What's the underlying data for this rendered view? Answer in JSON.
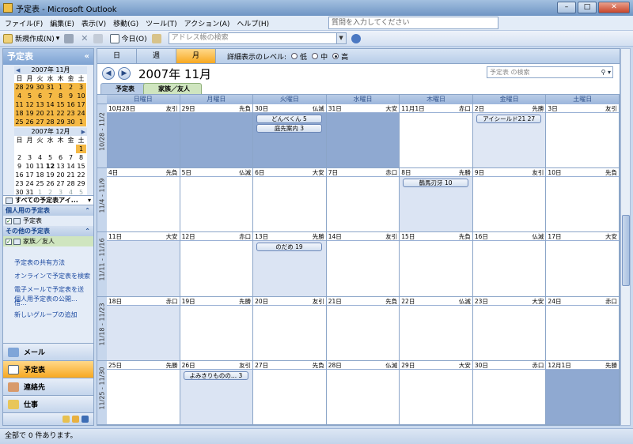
{
  "window": {
    "title": "予定表 - Microsoft Outlook"
  },
  "menu": {
    "items": [
      "ファイル(F)",
      "編集(E)",
      "表示(V)",
      "移動(G)",
      "ツール(T)",
      "アクション(A)",
      "ヘルプ(H)"
    ],
    "help_placeholder": "質問を入力してください"
  },
  "toolbar": {
    "new_label": "新規作成(N)",
    "today_label": "今日(O)",
    "address_placeholder": "アドレス帳の検索"
  },
  "leftpane": {
    "title": "予定表",
    "minical1": {
      "title": "2007年 11月",
      "headers": [
        "日",
        "月",
        "火",
        "水",
        "木",
        "金",
        "土"
      ],
      "days": [
        "28",
        "29",
        "30",
        "31",
        "1",
        "2",
        "3",
        "4",
        "5",
        "6",
        "7",
        "8",
        "9",
        "10",
        "11",
        "12",
        "13",
        "14",
        "15",
        "16",
        "17",
        "18",
        "19",
        "20",
        "21",
        "22",
        "23",
        "24",
        "25",
        "26",
        "27",
        "28",
        "29",
        "30",
        "1"
      ]
    },
    "minical2": {
      "title": "2007年 12月",
      "headers": [
        "日",
        "月",
        "火",
        "水",
        "木",
        "金",
        "土"
      ],
      "days": [
        "",
        "",
        "",
        "",
        "",
        "",
        "1",
        "2",
        "3",
        "4",
        "5",
        "6",
        "7",
        "8",
        "9",
        "10",
        "11",
        "12",
        "13",
        "14",
        "15",
        "16",
        "17",
        "18",
        "19",
        "20",
        "21",
        "22",
        "23",
        "24",
        "25",
        "26",
        "27",
        "28",
        "29",
        "30",
        "31",
        "1",
        "2",
        "3",
        "4",
        "5"
      ]
    },
    "all_calendars": "すべての予定表アイ...",
    "personal_header": "個人用の予定表",
    "personal_item": "予定表",
    "other_header": "その他の予定表",
    "other_item": "家族／友人",
    "links": [
      "予定表の共有方法",
      "オンラインで予定表を検索",
      "電子メールで予定表を送信...",
      "個人用予定表の公開...",
      "新しいグループの追加"
    ],
    "nav": [
      "メール",
      "予定表",
      "連絡先",
      "仕事"
    ]
  },
  "view": {
    "tabs": [
      "日",
      "週",
      "月"
    ],
    "detail_label": "詳細表示のレベル:",
    "levels": [
      "低",
      "中",
      "高"
    ],
    "month_title": "2007年 11月",
    "search_placeholder": "予定表 の検索",
    "cal_tabs": [
      "予定表",
      "家族／友人"
    ]
  },
  "calendar": {
    "weekdays": [
      "日曜日",
      "月曜日",
      "火曜日",
      "水曜日",
      "木曜日",
      "金曜日",
      "土曜日"
    ],
    "weeks": [
      {
        "label": "10/28 - 11/2",
        "days": [
          {
            "d": "10月28日",
            "r": "友引"
          },
          {
            "d": "29日",
            "r": "先負"
          },
          {
            "d": "30日",
            "r": "仏滅"
          },
          {
            "d": "31日",
            "r": "大安"
          },
          {
            "d": "11月1日",
            "r": "赤口"
          },
          {
            "d": "2日",
            "r": "先勝"
          },
          {
            "d": "3日",
            "r": "友引"
          }
        ]
      },
      {
        "label": "11/4 - 11/9",
        "days": [
          {
            "d": "4日",
            "r": "先負"
          },
          {
            "d": "5日",
            "r": "仏滅"
          },
          {
            "d": "6日",
            "r": "大安"
          },
          {
            "d": "7日",
            "r": "赤口"
          },
          {
            "d": "8日",
            "r": "先勝"
          },
          {
            "d": "9日",
            "r": "友引"
          },
          {
            "d": "10日",
            "r": "先負"
          }
        ]
      },
      {
        "label": "11/11 - 11/16",
        "days": [
          {
            "d": "11日",
            "r": "大安"
          },
          {
            "d": "12日",
            "r": "赤口"
          },
          {
            "d": "13日",
            "r": "先勝"
          },
          {
            "d": "14日",
            "r": "友引"
          },
          {
            "d": "15日",
            "r": "先負"
          },
          {
            "d": "16日",
            "r": "仏滅"
          },
          {
            "d": "17日",
            "r": "大安"
          }
        ]
      },
      {
        "label": "11/18 - 11/23",
        "days": [
          {
            "d": "18日",
            "r": "赤口"
          },
          {
            "d": "19日",
            "r": "先勝"
          },
          {
            "d": "20日",
            "r": "友引"
          },
          {
            "d": "21日",
            "r": "先負"
          },
          {
            "d": "22日",
            "r": "仏滅"
          },
          {
            "d": "23日",
            "r": "大安"
          },
          {
            "d": "24日",
            "r": "赤口"
          }
        ]
      },
      {
        "label": "11/25 - 11/30",
        "days": [
          {
            "d": "25日",
            "r": "先勝"
          },
          {
            "d": "26日",
            "r": "友引"
          },
          {
            "d": "27日",
            "r": "先負"
          },
          {
            "d": "28日",
            "r": "仏滅"
          },
          {
            "d": "29日",
            "r": "大安"
          },
          {
            "d": "30日",
            "r": "赤口"
          },
          {
            "d": "12月1日",
            "r": "先勝"
          }
        ]
      }
    ],
    "events": [
      {
        "week": 0,
        "day": 2,
        "row": 0,
        "text": "どんべくん 5"
      },
      {
        "week": 0,
        "day": 2,
        "row": 1,
        "text": "庭先案内 3"
      },
      {
        "week": 0,
        "day": 5,
        "row": 0,
        "text": "アイシールド21 27"
      },
      {
        "week": 1,
        "day": 4,
        "row": 0,
        "text": "鶴馬刃牙 10"
      },
      {
        "week": 2,
        "day": 2,
        "row": 0,
        "text": "のだめ 19"
      },
      {
        "week": 4,
        "day": 1,
        "row": 0,
        "text": "よみきりものの... 3"
      }
    ]
  },
  "status": {
    "text": "全部で 0 件あります。"
  }
}
